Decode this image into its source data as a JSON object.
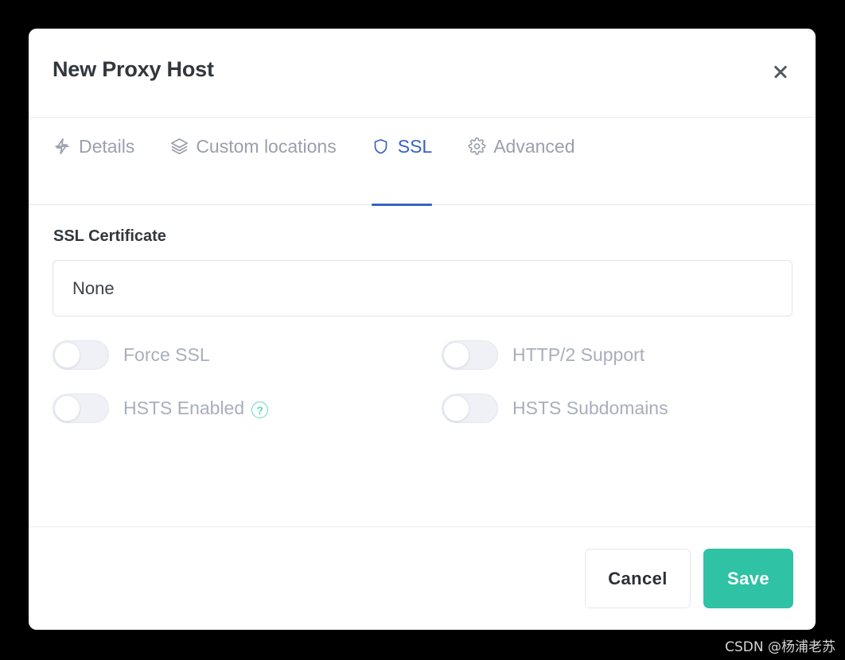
{
  "dialog": {
    "title": "New Proxy Host",
    "close_label": "×",
    "close_icon": "close-icon"
  },
  "tabs": [
    {
      "id": "details",
      "label": "Details",
      "icon": "zap-icon",
      "active": false
    },
    {
      "id": "custom-locations",
      "label": "Custom locations",
      "icon": "layers-icon",
      "active": false
    },
    {
      "id": "ssl",
      "label": "SSL",
      "icon": "shield-icon",
      "active": true
    },
    {
      "id": "advanced",
      "label": "Advanced",
      "icon": "gear-icon",
      "active": false
    }
  ],
  "ssl_panel": {
    "section_title": "SSL Certificate",
    "certificate_select": {
      "value": "None",
      "name": "ssl-certificate-select"
    },
    "toggles": [
      {
        "id": "force-ssl",
        "label": "Force SSL",
        "enabled": false,
        "on": false,
        "help": null
      },
      {
        "id": "http2-support",
        "label": "HTTP/2 Support",
        "enabled": false,
        "on": false,
        "help": null
      },
      {
        "id": "hsts-enabled",
        "label": "HSTS Enabled",
        "enabled": false,
        "on": false,
        "help": "?"
      },
      {
        "id": "hsts-subdomains",
        "label": "HSTS Subdomains",
        "enabled": false,
        "on": false,
        "help": null
      }
    ]
  },
  "footer": {
    "cancel_label": "Cancel",
    "save_label": "Save"
  },
  "watermark": "CSDN @杨浦老苏",
  "colors": {
    "accent_blue": "#3762c4",
    "save_green": "#2fc2a5",
    "help_teal": "#63d6bb",
    "muted_text": "#a9aebb",
    "title_text": "#32373d",
    "backdrop": "#000000",
    "surface": "#ffffff"
  }
}
